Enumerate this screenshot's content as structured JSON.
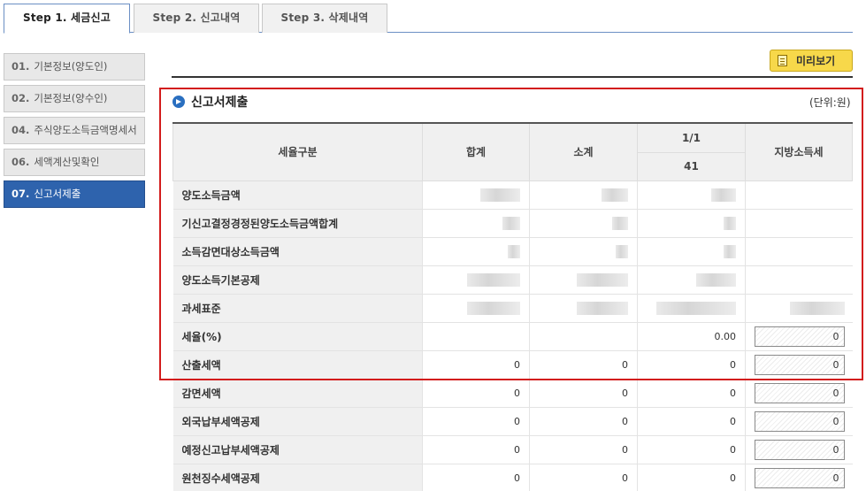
{
  "tabs": [
    {
      "label": "Step 1. 세금신고",
      "active": true
    },
    {
      "label": "Step 2. 신고내역",
      "active": false
    },
    {
      "label": "Step 3. 삭제내역",
      "active": false
    }
  ],
  "sidebar": {
    "items": [
      {
        "num": "01.",
        "label": "기본정보(양도인)",
        "active": false
      },
      {
        "num": "02.",
        "label": "기본정보(양수인)",
        "active": false
      },
      {
        "num": "04.",
        "label": "주식양도소득금액명세서",
        "active": false
      },
      {
        "num": "06.",
        "label": "세액계산및확인",
        "active": false
      },
      {
        "num": "07.",
        "label": "신고서제출",
        "active": true
      }
    ]
  },
  "toolbar": {
    "preview_label": "미리보기",
    "preview_icon": "document-icon"
  },
  "section": {
    "title": "신고서제출",
    "unit": "(단위:원)",
    "title_icon": "arrow-right-circle-icon"
  },
  "table": {
    "headers": {
      "category": "세율구분",
      "total": "합계",
      "subtotal": "소계",
      "page": "1/1",
      "code": "41",
      "local_tax": "지방소득세"
    },
    "rows": [
      {
        "label": "양도소득금액",
        "total": "",
        "subtotal": "",
        "code": "",
        "local": ""
      },
      {
        "label": "기신고결정경정된양도소득금액합계",
        "total": "",
        "subtotal": "",
        "code": "",
        "local": ""
      },
      {
        "label": "소득감면대상소득금액",
        "total": "",
        "subtotal": "",
        "code": "",
        "local": ""
      },
      {
        "label": "양도소득기본공제",
        "total": "",
        "subtotal": "",
        "code": "",
        "local": ""
      },
      {
        "label": "과세표준",
        "total": "",
        "subtotal": "",
        "code": "",
        "local": ""
      },
      {
        "label": "세율(%)",
        "total": "",
        "subtotal": "",
        "code": "0.00",
        "local": "0"
      },
      {
        "label": "산출세액",
        "total": "0",
        "subtotal": "0",
        "code": "0",
        "local": "0"
      },
      {
        "label": "감면세액",
        "total": "0",
        "subtotal": "0",
        "code": "0",
        "local": "0"
      },
      {
        "label": "외국납부세액공제",
        "total": "0",
        "subtotal": "0",
        "code": "0",
        "local": "0"
      },
      {
        "label": "예정신고납부세액공제",
        "total": "0",
        "subtotal": "0",
        "code": "0",
        "local": "0"
      },
      {
        "label": "원천징수세액공제",
        "total": "0",
        "subtotal": "0",
        "code": "0",
        "local": "0"
      }
    ]
  },
  "colors": {
    "accent": "#2e63ad",
    "highlight": "#d31c1c",
    "preview_button": "#f7d84a"
  }
}
